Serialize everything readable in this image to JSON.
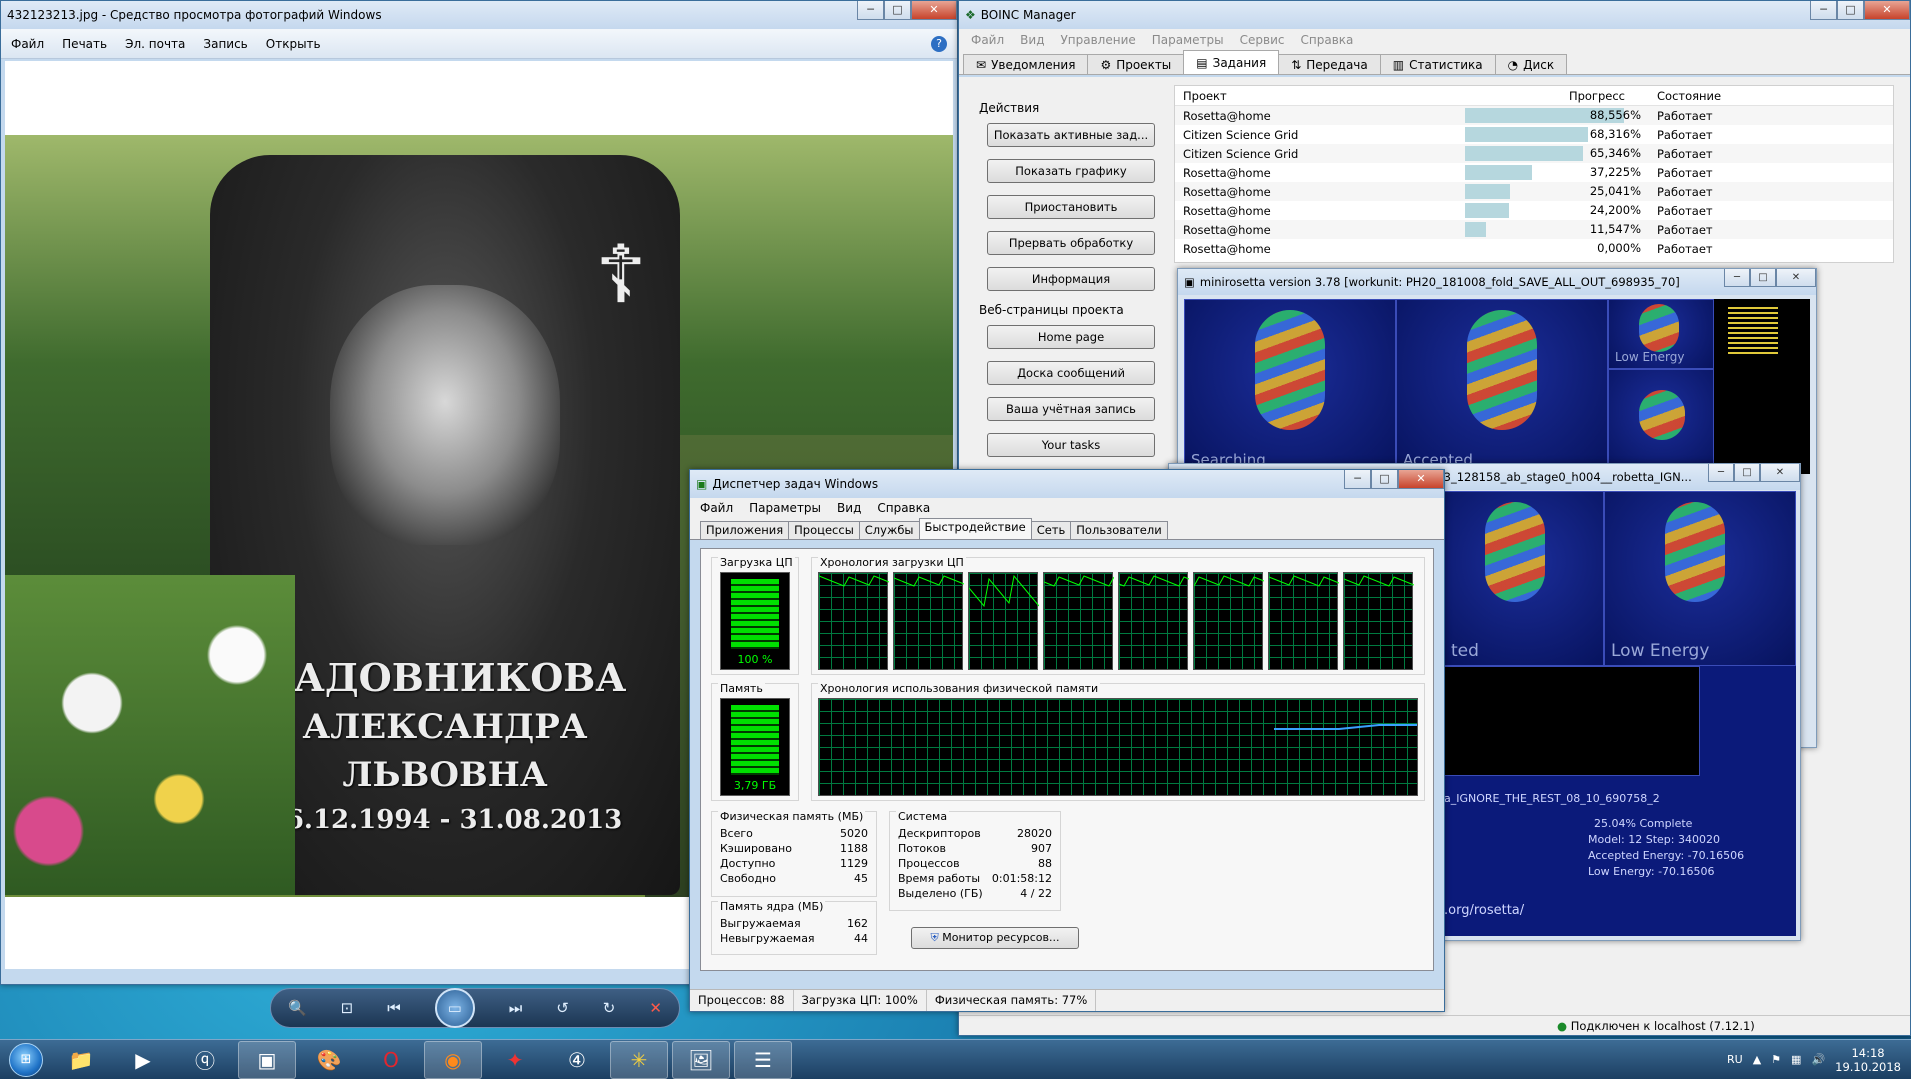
{
  "photo_viewer": {
    "title": "432123213.jpg - Средство просмотра фотографий Windows",
    "menu": [
      "Файл",
      "Печать",
      "Эл. почта",
      "Запись",
      "Открыть"
    ],
    "epitaph": {
      "surname": "САДОВНИКОВА",
      "name": "АЛЕКСАНДРА",
      "patronymic": "ЛЬВОВНА",
      "dates": "16.12.1994 - 31.08.2013"
    }
  },
  "boinc": {
    "title": "BOINC Manager",
    "menu": [
      "Файл",
      "Вид",
      "Управление",
      "Параметры",
      "Сервис",
      "Справка"
    ],
    "tabs": [
      "Уведомления",
      "Проекты",
      "Задания",
      "Передача",
      "Статистика",
      "Диск"
    ],
    "actions_heading": "Действия",
    "actions": [
      "Показать активные зад...",
      "Показать графику",
      "Приостановить",
      "Прервать обработку",
      "Информация"
    ],
    "web_heading": "Веб-страницы проекта",
    "web_links": [
      "Home page",
      "Доска сообщений",
      "Ваша учётная запись",
      "Your tasks"
    ],
    "columns": [
      "Проект",
      "Прогресс",
      "Состояние"
    ],
    "tasks": [
      {
        "project": "Rosetta@home",
        "progress": "88,556%",
        "fraction": 0.88556,
        "state": "Работает"
      },
      {
        "project": "Citizen Science Grid",
        "progress": "68,316%",
        "fraction": 0.68316,
        "state": "Работает"
      },
      {
        "project": "Citizen Science Grid",
        "progress": "65,346%",
        "fraction": 0.65346,
        "state": "Работает"
      },
      {
        "project": "Rosetta@home",
        "progress": "37,225%",
        "fraction": 0.37225,
        "state": "Работает"
      },
      {
        "project": "Rosetta@home",
        "progress": "25,041%",
        "fraction": 0.25041,
        "state": "Работает"
      },
      {
        "project": "Rosetta@home",
        "progress": "24,200%",
        "fraction": 0.242,
        "state": "Работает"
      },
      {
        "project": "Rosetta@home",
        "progress": "11,547%",
        "fraction": 0.11547,
        "state": "Работает"
      },
      {
        "project": "Rosetta@home",
        "progress": "0,000%",
        "fraction": 0.0,
        "state": "Работает"
      }
    ],
    "status": "Подключен к localhost (7.12.1)"
  },
  "graphics1": {
    "title": "minirosetta version 3.78 [workunit: PH20_181008_fold_SAVE_ALL_OUT_698935_70]",
    "labels": [
      "Searching",
      "Accepted",
      "Low Energy"
    ]
  },
  "graphics2": {
    "title": "963_128158_ab_stage0_h004__robetta_IGN...",
    "labels": [
      "ted",
      "Low Energy"
    ],
    "workunit_tail": "a_IGNORE_THE_REST_08_10_690758_2",
    "complete": "25.04% Complete",
    "model_step": "Model: 12  Step: 340020",
    "accepted_energy": "Accepted Energy: -70.16506",
    "low_energy": "Low Energy: -70.16506",
    "url_tail": ".org/rosetta/"
  },
  "task_manager": {
    "title": "Диспетчер задач Windows",
    "menu": [
      "Файл",
      "Параметры",
      "Вид",
      "Справка"
    ],
    "tabs": [
      "Приложения",
      "Процессы",
      "Службы",
      "Быстродействие",
      "Сеть",
      "Пользователи"
    ],
    "cpu_label": "Загрузка ЦП",
    "cpu_value": "100 %",
    "cpu_history_label": "Хронология загрузки ЦП",
    "mem_label": "Память",
    "mem_value": "3,79 ГБ",
    "mem_history_label": "Хронология использования физической памяти",
    "physical": {
      "title": "Физическая память (МБ)",
      "rows": [
        [
          "Всего",
          "5020"
        ],
        [
          "Кэшировано",
          "1188"
        ],
        [
          "Доступно",
          "1129"
        ],
        [
          "Свободно",
          "45"
        ]
      ]
    },
    "kernel": {
      "title": "Память ядра (МБ)",
      "rows": [
        [
          "Выгружаемая",
          "162"
        ],
        [
          "Невыгружаемая",
          "44"
        ]
      ]
    },
    "system": {
      "title": "Система",
      "rows": [
        [
          "Дескрипторов",
          "28020"
        ],
        [
          "Потоков",
          "907"
        ],
        [
          "Процессов",
          "88"
        ],
        [
          "Время работы",
          "0:01:58:12"
        ],
        [
          "Выделено (ГБ)",
          "4 / 22"
        ]
      ]
    },
    "resource_monitor": "Монитор ресурсов...",
    "statusbar": [
      "Процессов: 88",
      "Загрузка ЦП: 100%",
      "Физическая память: 77%"
    ]
  },
  "taskbar": {
    "lang": "RU",
    "time": "14:18",
    "date": "19.10.2018"
  }
}
